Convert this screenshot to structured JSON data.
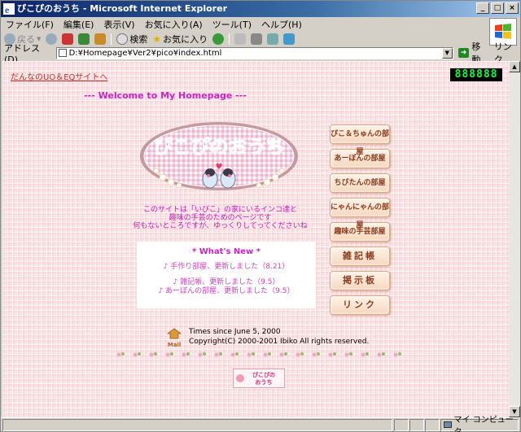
{
  "window": {
    "title": "ぴこぴのおうち - Microsoft Internet Explorer",
    "controls": {
      "minimize": "_",
      "maximize": "□",
      "close": "×"
    }
  },
  "menu": [
    "ファイル(F)",
    "編集(E)",
    "表示(V)",
    "お気に入り(A)",
    "ツール(T)",
    "ヘルプ(H)"
  ],
  "toolbar": {
    "back": "戻る",
    "search": "検索",
    "favorites": "お気に入り"
  },
  "address": {
    "label": "アドレス(D)",
    "value": "D:¥Homepage¥Ver2¥pico¥index.html",
    "go": "移動",
    "links": "リンク"
  },
  "page": {
    "top_link": "だんなのUO＆EQサイトへ",
    "counter": "888888",
    "welcome": "--- Welcome to My Homepage ---",
    "logo_text": "ぴこぴのおうち",
    "intro": [
      "このサイトは「いぴこ」の家にいるインコ達と",
      "趣味の手芸のためのページです",
      "何もないところですが、ゆっくりしてってくださいね"
    ],
    "news": {
      "title": "* What's New *",
      "items": [
        "♪ 手作り部屋、更新しました（8.21）",
        "♪ 雑記帳、更新しました（9.5）",
        "♪ あーぼんの部屋、更新しました（9.5）"
      ]
    },
    "nav": [
      "ぴこ＆ちゅんの部屋",
      "あーぼんの部屋",
      "ちびたんの部屋",
      "にゃんにゃんの部屋",
      "趣味の手芸部屋",
      "雑記帳",
      "掲示板",
      "リンク"
    ],
    "mail_label": "Mail",
    "footer": {
      "since": "Times since June 5, 2000",
      "copyright": "Copyright(C) 2000-2001 Ibiko All rights reserved."
    },
    "bottom_logo": [
      "ぴこぴの",
      "おうち"
    ]
  },
  "status": {
    "text": "",
    "zone": "マイ コンピュータ"
  },
  "colors": {
    "title_grad_start": "#0a246a",
    "page_bg": "#fbe4e6",
    "accent_pink": "#d020c8",
    "counter_green": "#00ff3a",
    "link_red": "#c0302a"
  }
}
